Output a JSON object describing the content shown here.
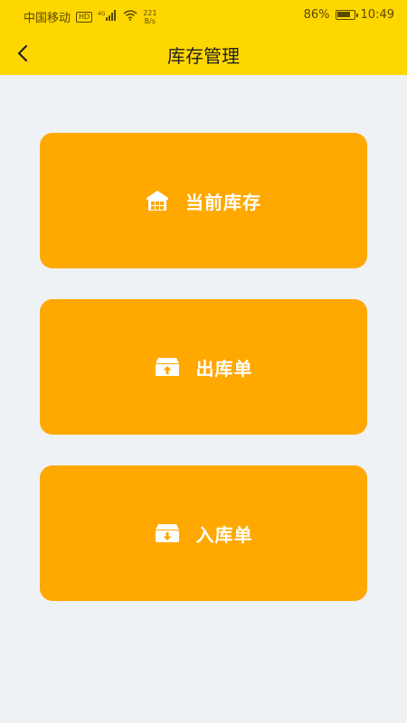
{
  "status_bar": {
    "carrier": "中国移动",
    "hd_badge": "HD",
    "network": "4G",
    "speed_value": "221",
    "speed_unit": "B/s",
    "battery": "86%",
    "battery_level": 0.86,
    "time": "10:49"
  },
  "header": {
    "title": "库存管理",
    "background": "#FFD700"
  },
  "cards": [
    {
      "label": "当前库存",
      "icon": "warehouse-icon"
    },
    {
      "label": "出库单",
      "icon": "box-out-icon"
    },
    {
      "label": "入库单",
      "icon": "box-in-icon"
    }
  ],
  "colors": {
    "card": "#FFA800",
    "page_bg": "#EEF2F5"
  }
}
